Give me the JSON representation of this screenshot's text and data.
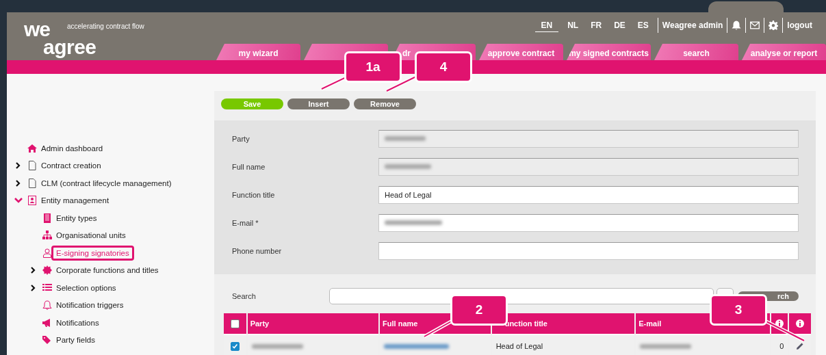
{
  "header": {
    "logo_top": "we",
    "logo_bottom": "agree",
    "tagline": "accelerating contract flow",
    "languages": [
      {
        "label": "EN",
        "selected": true
      },
      {
        "label": "NL",
        "selected": false
      },
      {
        "label": "FR",
        "selected": false
      },
      {
        "label": "DE",
        "selected": false
      },
      {
        "label": "ES",
        "selected": false
      }
    ],
    "user": "Weagree admin",
    "logout": "logout"
  },
  "tabs": [
    {
      "kind": "labeled",
      "label": "my wizard"
    },
    {
      "kind": "covered"
    },
    {
      "kind": "labeled",
      "label": "dr"
    },
    {
      "kind": "labeled",
      "label": "approve contract"
    },
    {
      "kind": "labeled",
      "label": "my signed contracts"
    },
    {
      "kind": "labeled",
      "label": "search"
    },
    {
      "kind": "labeled",
      "label": "analyse or report"
    }
  ],
  "sidebar": {
    "items": [
      {
        "label": "Admin dashboard",
        "kind": "home",
        "selected": false
      },
      {
        "label": "Contract creation",
        "kind": "document",
        "selected": false,
        "expanded": false
      },
      {
        "label": "CLM (contract lifecycle management)",
        "kind": "document",
        "selected": false,
        "expanded": false
      },
      {
        "label": "Entity management",
        "kind": "contact",
        "selected": false,
        "expanded": true,
        "children": [
          {
            "label": "Entity types",
            "kind": "building",
            "selected": false
          },
          {
            "label": "Organisational units",
            "kind": "sitemap",
            "selected": false
          },
          {
            "label": "E-signing signatories",
            "kind": "user",
            "selected": true
          },
          {
            "label": "Corporate functions and titles",
            "kind": "badge",
            "selected": false,
            "expanded": false
          },
          {
            "label": "Selection options",
            "kind": "list",
            "selected": false,
            "expanded": false
          },
          {
            "label": "Notification triggers",
            "kind": "bell",
            "selected": false
          },
          {
            "label": "Notifications",
            "kind": "megaphone",
            "selected": false
          },
          {
            "label": "Party fields",
            "kind": "tag",
            "selected": false
          }
        ]
      }
    ]
  },
  "toolbar": {
    "buttons": [
      {
        "label": "Save",
        "kind": "primary"
      },
      {
        "label": "Insert",
        "kind": "secondary"
      },
      {
        "label": "Remove",
        "kind": "secondary"
      }
    ]
  },
  "form": {
    "fields": [
      {
        "label": "Party",
        "disabled": true,
        "blurred": true
      },
      {
        "label": "Full name",
        "disabled": true,
        "blurred": true
      },
      {
        "label": "Function title",
        "disabled": false,
        "value": "Head of Legal"
      },
      {
        "label": "E-mail *",
        "disabled": false,
        "blurred": true
      },
      {
        "label": "Phone number",
        "disabled": false
      }
    ]
  },
  "search": {
    "label": "Search",
    "button": "rch"
  },
  "table": {
    "all_checked": false,
    "columns": [
      {
        "kind": "text",
        "label": "Party"
      },
      {
        "kind": "text",
        "label": "Full name"
      },
      {
        "kind": "text",
        "label": "unction title"
      },
      {
        "kind": "text",
        "label": "E-mail"
      },
      {
        "kind": "info"
      },
      {
        "kind": "info"
      }
    ],
    "rows": [
      {
        "checked": true,
        "cells": [
          {
            "kind": "blurred"
          },
          {
            "kind": "blurred-link"
          },
          {
            "kind": "text",
            "text": "Head of Legal"
          },
          {
            "kind": "blurred"
          },
          {
            "kind": "text",
            "text": "0"
          },
          {
            "kind": "edit"
          }
        ]
      }
    ]
  },
  "callouts": [
    {
      "label": "1a"
    },
    {
      "label": "4"
    },
    {
      "label": "2"
    },
    {
      "label": "3"
    }
  ]
}
